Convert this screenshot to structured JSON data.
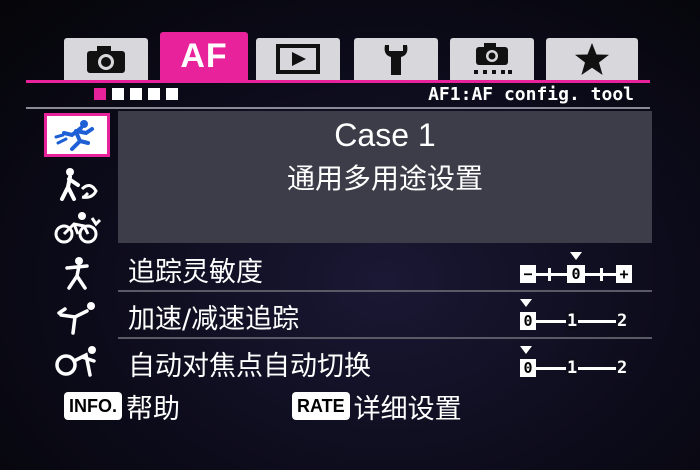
{
  "tabs": [
    {
      "id": "shooting",
      "icon": "camera-icon",
      "label": ""
    },
    {
      "id": "af",
      "icon": "",
      "label": "AF"
    },
    {
      "id": "playback",
      "icon": "play-icon",
      "label": ""
    },
    {
      "id": "setup",
      "icon": "wrench-icon",
      "label": ""
    },
    {
      "id": "custom",
      "icon": "custom-camera-icon",
      "label": ""
    },
    {
      "id": "mymenu",
      "icon": "star-icon",
      "label": ""
    }
  ],
  "active_tab": "af",
  "header": {
    "title": "AF1:AF config. tool",
    "pages_total": 5,
    "page_active": 1
  },
  "case_icons": [
    {
      "icon": "versatile-runner-icon",
      "selected": true
    },
    {
      "icon": "obstacle-icon",
      "selected": false
    },
    {
      "icon": "cyclist-icon",
      "selected": false
    },
    {
      "icon": "sudden-speed-icon",
      "selected": false
    },
    {
      "icon": "erratic-movement-icon",
      "selected": false
    },
    {
      "icon": "varied-subject-icon",
      "selected": false
    }
  ],
  "case": {
    "title": "Case 1",
    "description": "通用多用途设置"
  },
  "params": [
    {
      "label": "追踪灵敏度",
      "scale_type": "pm",
      "labels": [
        "−",
        "0",
        "+"
      ],
      "value": 0
    },
    {
      "label": "加速/减速追踪",
      "scale_type": "012",
      "labels": [
        "0",
        "1",
        "2"
      ],
      "value": 0
    },
    {
      "label": "自动对焦点自动切换",
      "scale_type": "012",
      "labels": [
        "0",
        "1",
        "2"
      ],
      "value": 0
    }
  ],
  "footer": {
    "info_key": "INFO.",
    "info_label": "帮助",
    "rate_key": "RATE",
    "rate_label": "详细设置"
  },
  "colors": {
    "accent": "#e8229a",
    "panel": "#3d3c49",
    "tab_inactive": "#d8d8dc"
  }
}
